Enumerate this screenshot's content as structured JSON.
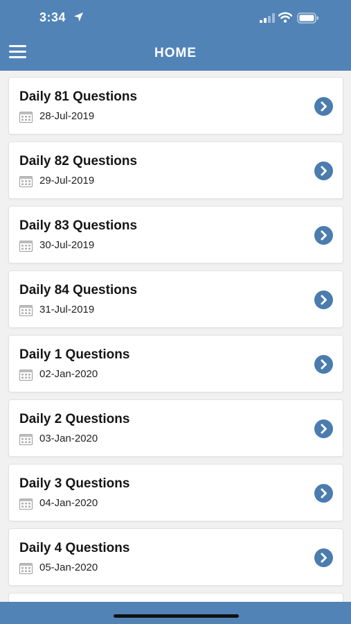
{
  "status_bar": {
    "time": "3:34"
  },
  "nav": {
    "title": "HOME"
  },
  "items": [
    {
      "title": "Daily 81 Questions",
      "date": "28-Jul-2019"
    },
    {
      "title": "Daily 82 Questions",
      "date": "29-Jul-2019"
    },
    {
      "title": "Daily 83 Questions",
      "date": "30-Jul-2019"
    },
    {
      "title": "Daily 84 Questions",
      "date": "31-Jul-2019"
    },
    {
      "title": "Daily 1 Questions",
      "date": "02-Jan-2020"
    },
    {
      "title": "Daily 2 Questions",
      "date": "03-Jan-2020"
    },
    {
      "title": "Daily 3 Questions",
      "date": "04-Jan-2020"
    },
    {
      "title": "Daily 4 Questions",
      "date": "05-Jan-2020"
    }
  ],
  "colors": {
    "header": "#5183b7",
    "chevron": "#4a7cae",
    "background": "#f1f1f1"
  },
  "icons": {
    "menu": "hamburger-icon",
    "date": "calendar-icon",
    "open": "chevron-right-icon"
  }
}
